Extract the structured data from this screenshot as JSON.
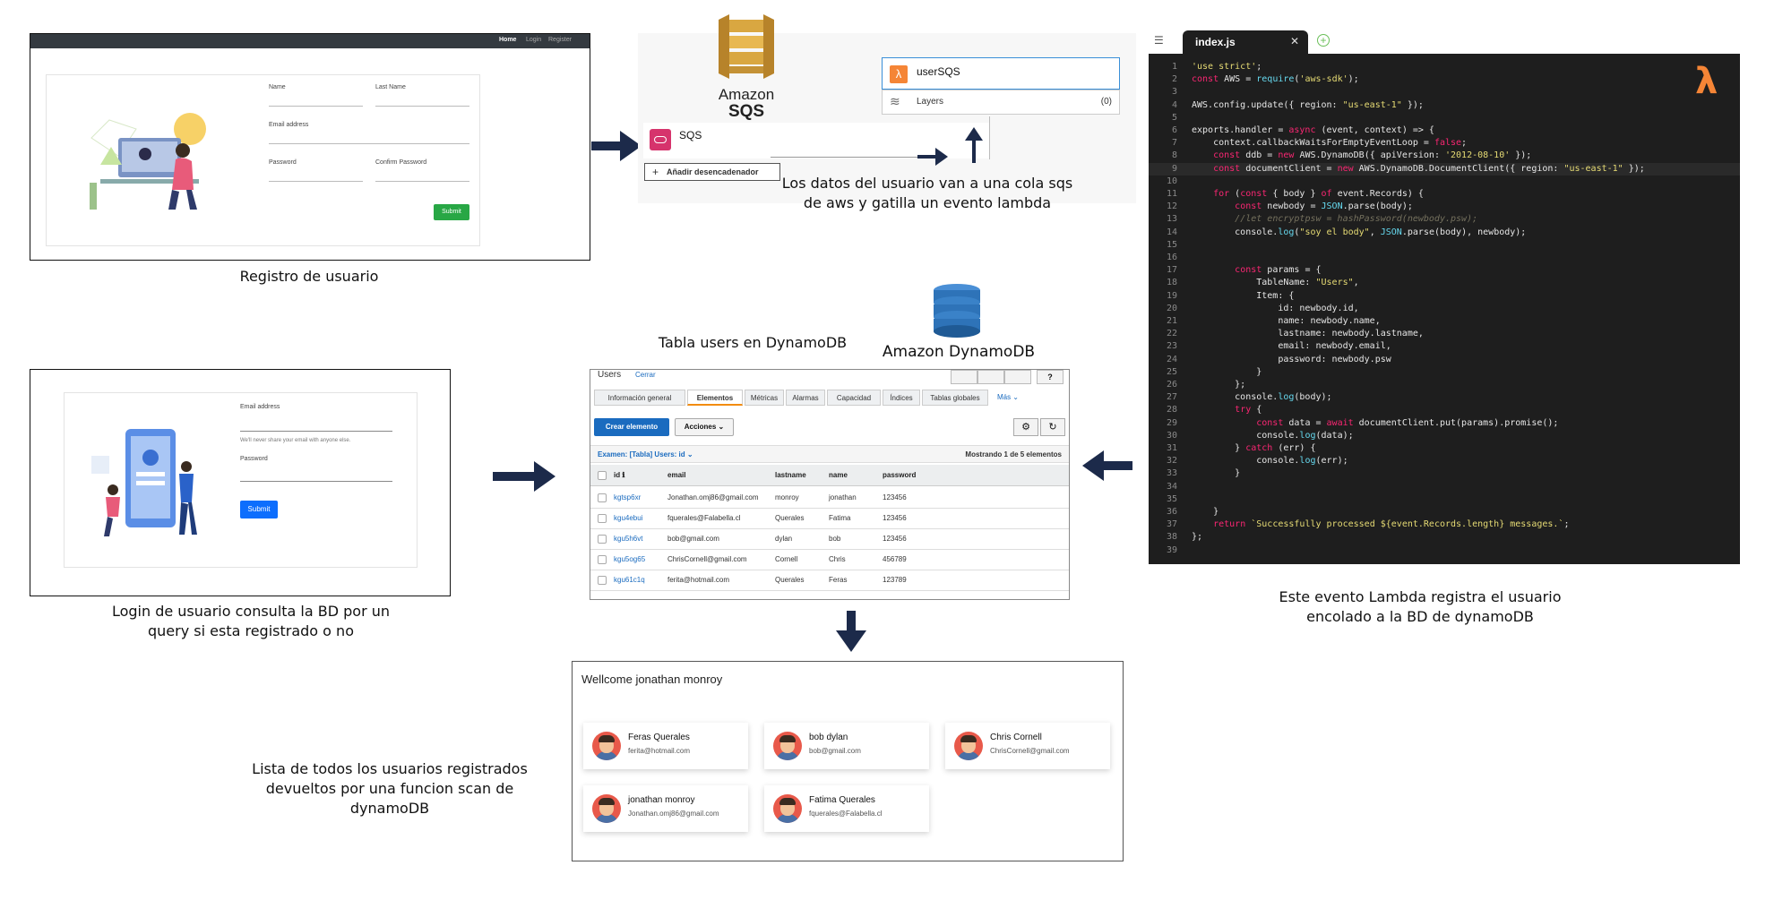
{
  "registro": {
    "nav": [
      "Home",
      "Login",
      "Register"
    ],
    "fields": {
      "name": "Name",
      "last_name": "Last Name",
      "email": "Email address",
      "password": "Password",
      "confirm": "Confirm Password"
    },
    "submit": "Submit",
    "caption": "Registro de usuario"
  },
  "sqs": {
    "logo_line1": "Amazon",
    "logo_line2": "SQS",
    "function_name": "userSQS",
    "layers_label": "Layers",
    "layers_count": "(0)",
    "trigger_name": "SQS",
    "add_trigger": "Añadir desencadenador",
    "caption_line1": "Los datos del usuario van a una cola sqs",
    "caption_line2": "de aws y gatilla un evento lambda"
  },
  "editor": {
    "tab": "index.js",
    "lines": [
      "'use strict';",
      "const AWS = require('aws-sdk');",
      "",
      "AWS.config.update({ region: \"us-east-1\" });",
      "",
      "exports.handler = async (event, context) => {",
      "    context.callbackWaitsForEmptyEventLoop = false;",
      "    const ddb = new AWS.DynamoDB({ apiVersion: '2012-08-10' });",
      "    const documentClient = new AWS.DynamoDB.DocumentClient({ region: \"us-east-1\" });",
      "",
      "    for (const { body } of event.Records) {",
      "        const newbody = JSON.parse(body);",
      "        //let encryptpsw = hashPassword(newbody.psw);",
      "        console.log(\"soy el body\", JSON.parse(body), newbody);",
      "",
      "",
      "        const params = {",
      "            TableName: \"Users\",",
      "            Item: {",
      "                id: newbody.id,",
      "                name: newbody.name,",
      "                lastname: newbody.lastname,",
      "                email: newbody.email,",
      "                password: newbody.psw",
      "            }",
      "        };",
      "        console.log(body);",
      "        try {",
      "            const data = await documentClient.put(params).promise();",
      "            console.log(data);",
      "        } catch (err) {",
      "            console.log(err);",
      "        }",
      "",
      "",
      "    }",
      "    return `Successfully processed ${event.Records.length} messages.`;",
      "};",
      ""
    ],
    "caption_line1": "Este evento Lambda registra el usuario",
    "caption_line2": "encolado a la BD de dynamoDB"
  },
  "login": {
    "email_label": "Email address",
    "help": "We'll never share your email with anyone else.",
    "password_label": "Password",
    "submit": "Submit",
    "caption_line1": "Login de usuario consulta la BD por un",
    "caption_line2": "query si esta registrado o no"
  },
  "dynamo": {
    "heading": "Tabla users en DynamoDB",
    "logo_text": "Amazon DynamoDB",
    "title": "Users",
    "close": "Cerrar",
    "tabs": [
      "Información general",
      "Elementos",
      "Métricas",
      "Alarmas",
      "Capacidad",
      "Índices",
      "Tablas globales",
      "Más ⌄"
    ],
    "create_button": "Crear elemento",
    "actions_button": "Acciones ⌄",
    "scan_label": "Examen: [Tabla] Users: id ⌄",
    "showing": "Mostrando 1 de 5 elementos",
    "columns": [
      "id ℹ",
      "email",
      "lastname",
      "name",
      "password"
    ],
    "rows": [
      [
        "kgtsp6xr",
        "Jonathan.omj86@gmail.com",
        "monroy",
        "jonathan",
        "123456"
      ],
      [
        "kgu4ebui",
        "fquerales@Falabella.cl",
        "Querales",
        "Fatima",
        "123456"
      ],
      [
        "kgu5h6vt",
        "bob@gmail.com",
        "dylan",
        "bob",
        "123456"
      ],
      [
        "kgu5og65",
        "ChrisCornell@gmail.com",
        "Cornell",
        "Chris",
        "456789"
      ],
      [
        "kgu61c1q",
        "ferita@hotmail.com",
        "Querales",
        "Feras",
        "123789"
      ]
    ]
  },
  "welcome": {
    "title": "Wellcome jonathan monroy",
    "cards": [
      {
        "name": "Feras Querales",
        "email": "ferita@hotmail.com"
      },
      {
        "name": "bob dylan",
        "email": "bob@gmail.com"
      },
      {
        "name": "Chris Cornell",
        "email": "ChrisCornell@gmail.com"
      },
      {
        "name": "jonathan monroy",
        "email": "Jonathan.omj86@gmail.com"
      },
      {
        "name": "Fatima Querales",
        "email": "fquerales@Falabella.cl"
      }
    ],
    "caption_line1": "Lista de todos los usuarios registrados",
    "caption_line2": "devueltos por una funcion scan de",
    "caption_line3": "dynamoDB"
  },
  "colors": {
    "arrow": "#1c2a4a",
    "lambda": "#f58536",
    "sqs": "#d9a741",
    "dynamo": "#2e73b8",
    "green": "#28a745",
    "blue": "#0d6efd"
  }
}
